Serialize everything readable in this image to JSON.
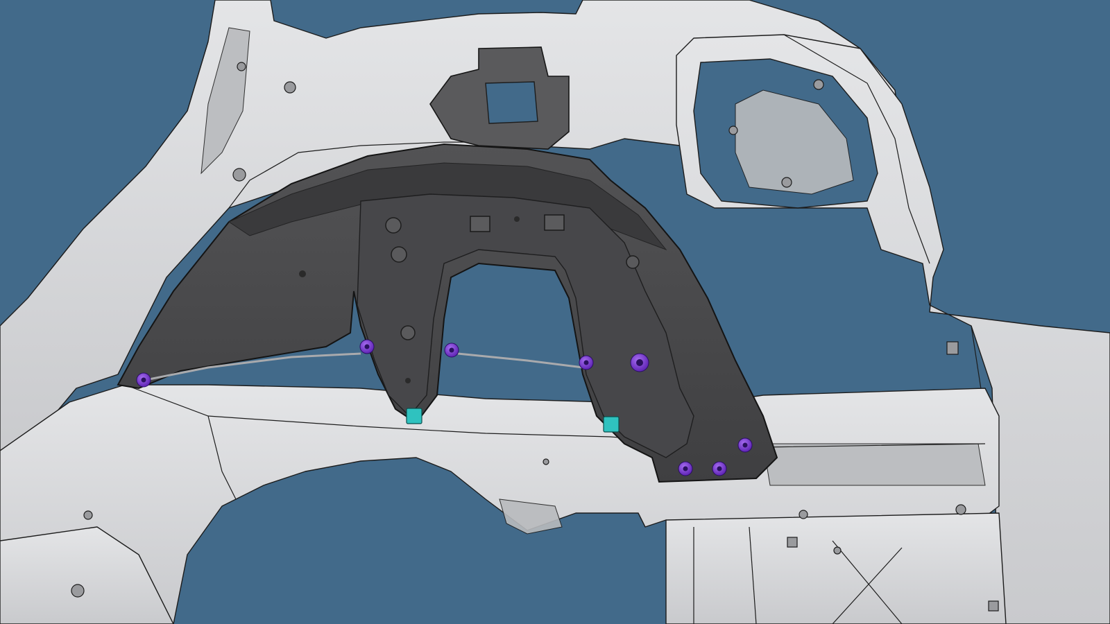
{
  "scene": {
    "background_color": "#426a8a",
    "body_panel_color": "#d7d8da",
    "body_panel_shadow": "#b9bbbe",
    "outline_color": "#1c1c1c",
    "wheelhouse_liner_color": "#4a4a4c",
    "wheelhouse_liner_dark": "#3a3a3c",
    "clip_color": "#7a2fd6",
    "clip_core_color": "#2a1160",
    "nut_color": "#2fc2bf",
    "clips": [
      {
        "id": "clip-1"
      },
      {
        "id": "clip-2"
      },
      {
        "id": "clip-3"
      },
      {
        "id": "clip-4"
      },
      {
        "id": "clip-5"
      },
      {
        "id": "clip-6"
      },
      {
        "id": "clip-7"
      },
      {
        "id": "clip-8"
      }
    ],
    "nuts": [
      {
        "id": "nut-1"
      },
      {
        "id": "nut-2"
      }
    ]
  }
}
